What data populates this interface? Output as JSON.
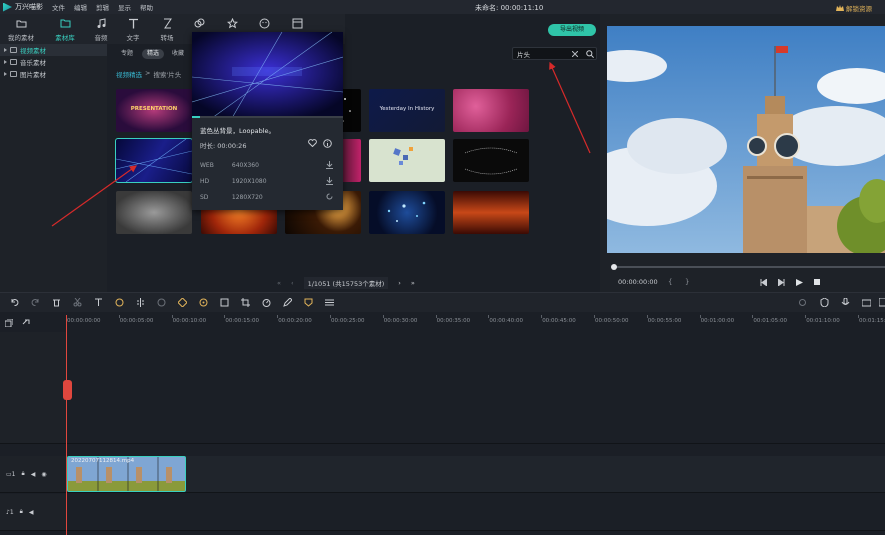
{
  "app": {
    "name": "万兴喵影",
    "title": "未命名: 00:00:11:10",
    "vip_label": "解锁资源"
  },
  "menu": [
    "文件",
    "编辑",
    "剪辑",
    "显示",
    "帮助"
  ],
  "toolbar": [
    {
      "label": "我的素材",
      "icon": "folder-icon"
    },
    {
      "label": "素材库",
      "icon": "library-icon",
      "active": true
    },
    {
      "label": "音频",
      "icon": "music-icon"
    },
    {
      "label": "文字",
      "icon": "text-icon"
    },
    {
      "label": "转场",
      "icon": "transition-icon"
    },
    {
      "label": "",
      "icon": "effects-icon"
    },
    {
      "label": "",
      "icon": "elements-icon"
    },
    {
      "label": "",
      "icon": "sticker-icon"
    },
    {
      "label": "",
      "icon": "split-screen-icon"
    }
  ],
  "tree": [
    {
      "label": "视频素材",
      "selected": true
    },
    {
      "label": "音乐素材",
      "selected": false
    },
    {
      "label": "图片素材",
      "selected": false
    }
  ],
  "filters": [
    "专题",
    "精选",
    "收藏"
  ],
  "search": {
    "value": "片头",
    "placeholder": ""
  },
  "breadcrumb": {
    "root": "视频精选",
    "sep": ">",
    "current": "搜索'片头"
  },
  "thumbs": [
    {
      "text": "PRESENTATION",
      "style": "t1"
    },
    {
      "text": "",
      "style": "t2"
    },
    {
      "text": "",
      "style": "t3"
    },
    {
      "text": "Yesterday In History",
      "style": "t4"
    },
    {
      "text": "",
      "style": "t5"
    },
    {
      "text": "",
      "style": "t6",
      "selected": true
    },
    {
      "text": "",
      "style": "t7"
    },
    {
      "text": "",
      "style": "t8"
    },
    {
      "text": "",
      "style": "t9"
    },
    {
      "text": "",
      "style": "t10"
    },
    {
      "text": "",
      "style": "t11"
    },
    {
      "text": "",
      "style": "t12"
    },
    {
      "text": "",
      "style": "t13"
    },
    {
      "text": "",
      "style": "t14"
    },
    {
      "text": "",
      "style": "t15"
    }
  ],
  "pager": {
    "text": "1/1051 (共15753个素材)"
  },
  "popup": {
    "description": "蓝色丛背景，Loopable。",
    "duration_label": "时长: 00:00:26",
    "progress": 0.05,
    "rows": [
      {
        "key": "WEB",
        "value": "640X360"
      },
      {
        "key": "HD",
        "value": "1920X1080"
      },
      {
        "key": "SD",
        "value": "1280X720"
      }
    ]
  },
  "preview": {
    "export_label": "导出视频",
    "timecode": "00:00:00:00"
  },
  "ruler": [
    "00:00:00:00",
    "00:00:05:00",
    "00:00:10:00",
    "00:00:15:00",
    "00:00:20:00",
    "00:00:25:00",
    "00:00:30:00",
    "00:00:35:00",
    "00:00:40:00",
    "00:00:45:00",
    "00:00:50:00",
    "00:00:55:00",
    "00:01:00:00",
    "00:01:05:00",
    "00:01:10:00",
    "00:01:15:00"
  ],
  "clip": {
    "label": "20220707112814.mp4"
  },
  "tracks": {
    "video": "1",
    "audio": "1"
  },
  "colors": {
    "accent": "#39d0c0",
    "playhead": "#e0473e",
    "export": "#2fc4a8"
  }
}
